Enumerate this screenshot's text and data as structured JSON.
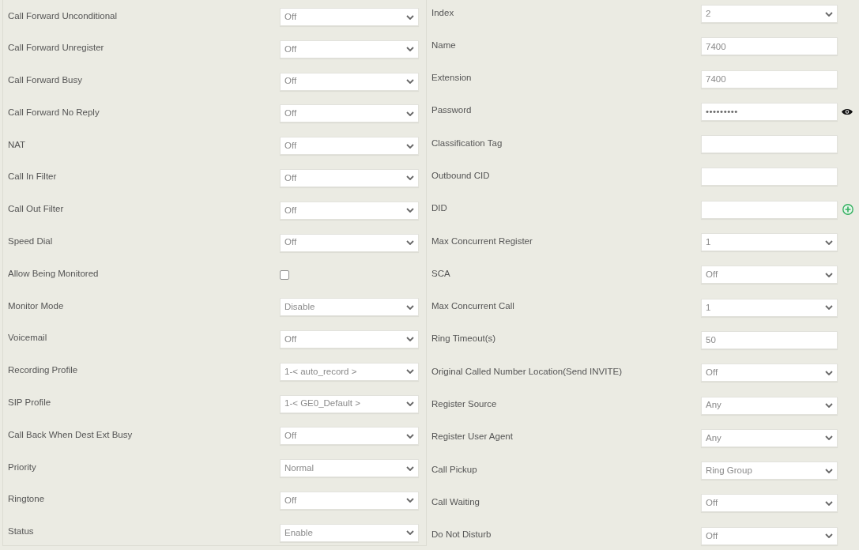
{
  "left_panel": {
    "fields": [
      {
        "label": "Call Forward Unconditional",
        "kind": "select",
        "value": "Off"
      },
      {
        "label": "Call Forward Unregister",
        "kind": "select",
        "value": "Off"
      },
      {
        "label": "Call Forward Busy",
        "kind": "select",
        "value": "Off"
      },
      {
        "label": "Call Forward No Reply",
        "kind": "select",
        "value": "Off"
      },
      {
        "label": "NAT",
        "kind": "select",
        "value": "Off"
      },
      {
        "label": "Call In Filter",
        "kind": "select",
        "value": "Off"
      },
      {
        "label": "Call Out Filter",
        "kind": "select",
        "value": "Off"
      },
      {
        "label": "Speed Dial",
        "kind": "select",
        "value": "Off"
      },
      {
        "label": "Allow Being Monitored",
        "kind": "checkbox",
        "checked": false
      },
      {
        "label": "Monitor Mode",
        "kind": "select",
        "value": "Disable"
      },
      {
        "label": "Voicemail",
        "kind": "select",
        "value": "Off"
      },
      {
        "label": "Recording Profile",
        "kind": "select",
        "value": "1-< auto_record >"
      },
      {
        "label": "SIP Profile",
        "kind": "select",
        "value": "1-< GE0_Default >"
      },
      {
        "label": "Call Back When Dest Ext Busy",
        "kind": "select",
        "value": "Off"
      },
      {
        "label": "Priority",
        "kind": "select",
        "value": "Normal"
      },
      {
        "label": "Ringtone",
        "kind": "select",
        "value": "Off"
      },
      {
        "label": "Status",
        "kind": "select",
        "value": "Enable"
      }
    ]
  },
  "right_panel": {
    "fields": [
      {
        "label": "Index",
        "kind": "select",
        "value": "2"
      },
      {
        "label": "Name",
        "kind": "text",
        "value": "7400"
      },
      {
        "label": "Extension",
        "kind": "text",
        "value": "7400"
      },
      {
        "label": "Password",
        "kind": "password",
        "value": "•••••••••"
      },
      {
        "label": "Classification Tag",
        "kind": "text"
      },
      {
        "label": "Outbound CID",
        "kind": "text"
      },
      {
        "label": "DID",
        "kind": "multi"
      },
      {
        "label": "Max Concurrent Register",
        "kind": "select",
        "value": "1"
      },
      {
        "label": "SCA",
        "kind": "select",
        "value": "Off"
      },
      {
        "label": "Max Concurrent Call",
        "kind": "select",
        "value": "1"
      },
      {
        "label": "Ring Timeout(s)",
        "kind": "text",
        "value": "50"
      },
      {
        "label": "Original Called Number Location(Send INVITE)",
        "kind": "select",
        "value": "Off"
      },
      {
        "label": "Register Source",
        "kind": "select",
        "value": "Any"
      },
      {
        "label": "Register User Agent",
        "kind": "select",
        "value": "Any"
      },
      {
        "label": "Call Pickup",
        "kind": "select",
        "value": "Ring Group"
      },
      {
        "label": "Call Waiting",
        "kind": "select",
        "value": "Off"
      },
      {
        "label": "Do Not Disturb",
        "kind": "select",
        "value": "Off"
      }
    ]
  }
}
